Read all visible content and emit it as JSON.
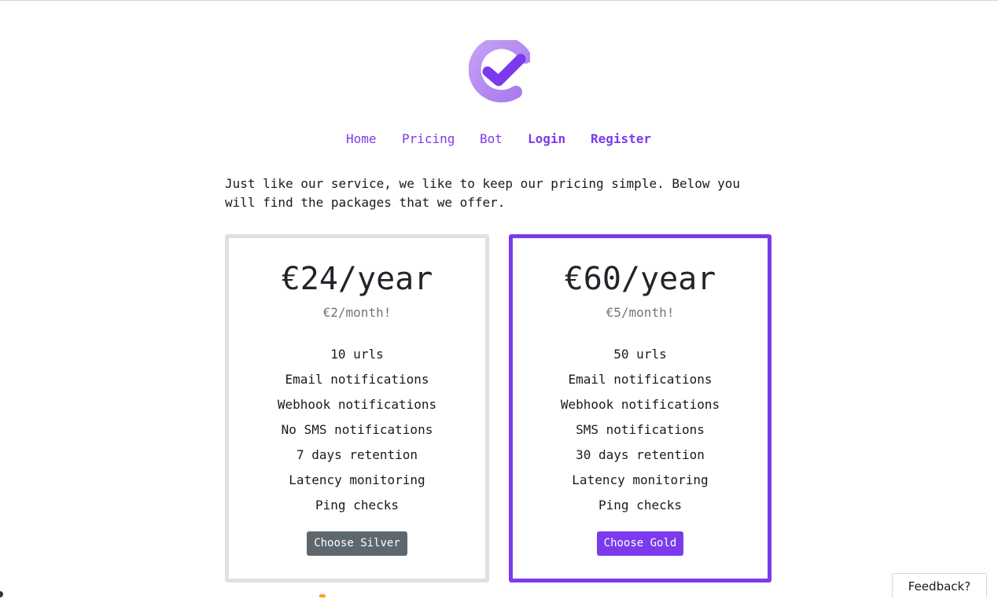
{
  "nav": {
    "home": "Home",
    "pricing": "Pricing",
    "bot": "Bot",
    "login": "Login",
    "register": "Register"
  },
  "intro": "Just like our service, we like to keep our pricing simple. Below you will find the packages that we offer.",
  "plans": [
    {
      "price": "€24/year",
      "monthly": "€2/month!",
      "features": [
        "10 urls",
        "Email notifications",
        "Webhook notifications",
        "No SMS notifications",
        "7 days retention",
        "Latency monitoring",
        "Ping checks"
      ],
      "button": "Choose Silver"
    },
    {
      "price": "€60/year",
      "monthly": "€5/month!",
      "features": [
        "50 urls",
        "Email notifications",
        "Webhook notifications",
        "SMS notifications",
        "30 days retention",
        "Latency monitoring",
        "Ping checks"
      ],
      "button": "Choose Gold"
    }
  ],
  "feedback": "Feedback?",
  "colors": {
    "accent": "#7c3aed",
    "silver_button": "#5f676e",
    "silver_border": "#dde1e5"
  }
}
